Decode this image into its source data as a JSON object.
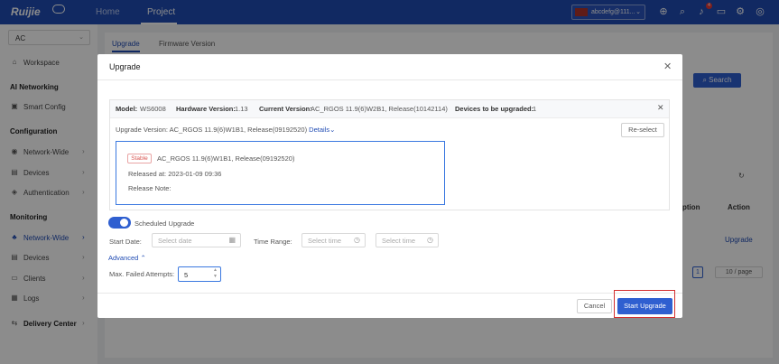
{
  "topbar": {
    "logo": "Ruijie",
    "nav": [
      "Home",
      "Project"
    ],
    "active_nav": "Project",
    "account": "abcdefg@111...",
    "notification_count": "4"
  },
  "sidebar": {
    "scope": "AC",
    "workspace": "Workspace",
    "ai_networking_header": "AI Networking",
    "smart_config": "Smart Config",
    "configuration_header": "Configuration",
    "config_items": [
      "Network-Wide",
      "Devices",
      "Authentication"
    ],
    "monitoring_header": "Monitoring",
    "monitoring_items": [
      "Network-Wide",
      "Devices",
      "Clients",
      "Logs"
    ],
    "delivery_center": "Delivery Center"
  },
  "background": {
    "tabs": [
      "Upgrade",
      "Firmware Version"
    ],
    "search_button": "Search",
    "col_option": "ption",
    "col_action": "Action",
    "row_action": "Upgrade",
    "page": "1",
    "page_size": "10 / page"
  },
  "modal": {
    "title": "Upgrade",
    "info": {
      "model_label": "Model:",
      "model": "WS6008",
      "hw_label": "Hardware Version:",
      "hw": "1.13",
      "cur_label": "Current Version:",
      "cur": "AC_RGOS 11.9(6)W2B1, Release(10142114)",
      "count_label": "Devices to be upgraded:",
      "count": "1"
    },
    "upgrade_version_prefix": "Upgrade Version: AC_RGOS 11.9(6)W1B1, Release(09192520)",
    "details": "Details",
    "reselect": "Re-select",
    "version_card": {
      "tag": "Stable",
      "name": "AC_RGOS 11.9(6)W1B1, Release(09192520)",
      "released": "Released at: 2023-01-09 09:36",
      "note": "Release Note:"
    },
    "scheduled_label": "Scheduled Upgrade",
    "start_date_label": "Start Date:",
    "start_date_placeholder": "Select date",
    "time_range_label": "Time Range:",
    "time_start_placeholder": "Select time",
    "time_end_placeholder": "Select time",
    "advanced": "Advanced",
    "max_failed_label": "Max. Failed Attempts:",
    "max_failed_value": "5",
    "cancel": "Cancel",
    "start_upgrade": "Start Upgrade"
  },
  "colors": {
    "brand": "#1f4bb3",
    "primary": "#2f5fd0",
    "highlight": "#d32f2f"
  }
}
